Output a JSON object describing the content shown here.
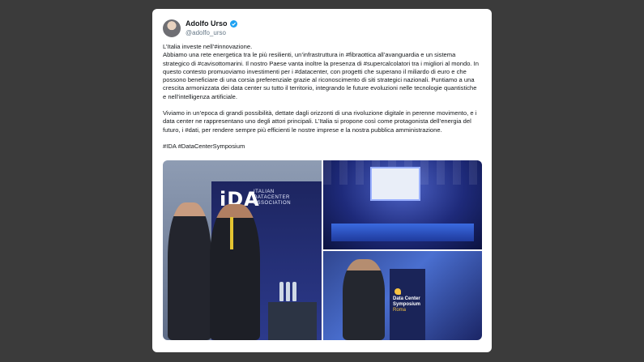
{
  "tweet": {
    "author": {
      "display_name": "Adolfo Urso",
      "handle": "@adolfo_urso",
      "verified_icon": "verified-badge-icon"
    },
    "paragraphs": [
      "L’Italia investe nell’#innovazione.\nAbbiamo una rete energetica tra le più resilienti, un’infrastruttura in #fibraottica all’avanguardia e un sistema strategico di #cavisottomarini. Il nostro Paese vanta inoltre la presenza di #supercalcolatori tra i migliori al mondo. In questo contesto promuoviamo investimenti per i #datacenter, con progetti che superano il miliardo di euro e che possono beneficiare di una corsia preferenziale grazie al riconoscimento di siti strategici nazionali. Puntiamo a una crescita armonizzata dei data center su tutto il territorio, integrando le future evoluzioni nelle tecnologie quantistiche e nell’intelligenza artificiale.",
      "Viviamo in un’epoca di grandi possibilità, dettate dagli orizzonti di una rivoluzione digitale in perenne movimento, e i data center ne rappresentano uno degli attori principali. L’Italia si propone così come protagonista dell’energia del futuro, i #dati, per rendere sempre più efficienti le nostre imprese e la nostra pubblica amministrazione.",
      "#IDA #DataCenterSymposium"
    ],
    "media": {
      "photo_left": {
        "logo": "iDA",
        "logo_subtitle_lines": [
          "ITALIAN",
          "DATACENTER",
          "ASSOCIATION"
        ]
      },
      "photo_bottom_right": {
        "podium_lines": [
          "Data Center",
          "Symposium"
        ],
        "podium_city": "Roma"
      }
    }
  },
  "colors": {
    "background": "#3b3b3b",
    "verified": "#1da1f2",
    "brand_navy": "#1d2560",
    "accent_yellow": "#f6c342"
  }
}
